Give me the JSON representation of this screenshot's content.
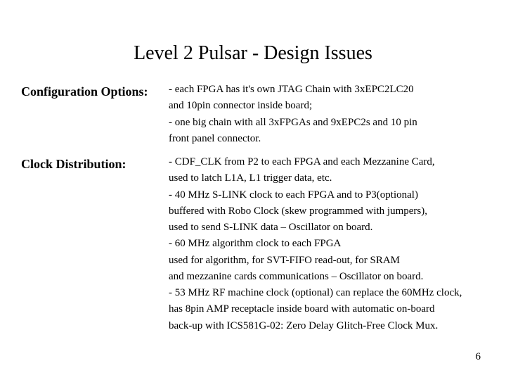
{
  "title": "Level 2 Pulsar - Design Issues",
  "sections": {
    "config": {
      "label": "Configuration Options:",
      "body": "- each FPGA has it's own JTAG Chain with 3xEPC2LC20\n   and 10pin connector inside board;\n- one big chain with all 3xFPGAs and 9xEPC2s and 10 pin\n   front panel connector."
    },
    "clock": {
      "label": "Clock Distribution:",
      "body": "- CDF_CLK from P2 to each FPGA and each Mezzanine Card,\n   used to latch L1A, L1 trigger data, etc.\n- 40 MHz S-LINK clock to each FPGA and to P3(optional)\n   buffered with Robo Clock (skew programmed with jumpers),\n   used to send S-LINK data – Oscillator on board.\n- 60 MHz algorithm clock to each FPGA\n   used for algorithm, for SVT-FIFO read-out, for SRAM\n   and mezzanine cards communications – Oscillator on board.\n- 53 MHz RF machine clock (optional) can replace the 60MHz clock,\n   has 8pin AMP receptacle inside board with automatic on-board\n   back-up with ICS581G-02: Zero Delay Glitch-Free Clock Mux."
    }
  },
  "page_number": "6"
}
